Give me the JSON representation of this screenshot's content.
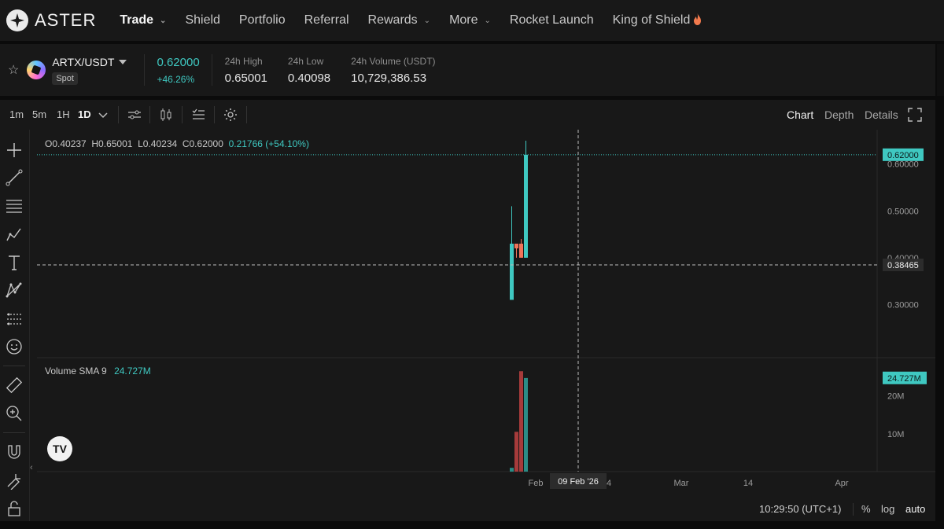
{
  "nav": {
    "brand": "ASTER",
    "items": [
      {
        "label": "Trade",
        "dropdown": true,
        "active": true
      },
      {
        "label": "Shield",
        "dropdown": false
      },
      {
        "label": "Portfolio",
        "dropdown": false
      },
      {
        "label": "Referral",
        "dropdown": false
      },
      {
        "label": "Rewards",
        "dropdown": true
      },
      {
        "label": "More",
        "dropdown": true
      },
      {
        "label": "Rocket Launch",
        "dropdown": false
      },
      {
        "label": "King of Shield",
        "dropdown": false,
        "icon": "flame-icon"
      }
    ]
  },
  "ticker": {
    "pair": "ARTX/USDT",
    "market": "Spot",
    "price": "0.62000",
    "change": "+46.26%",
    "high_label": "24h High",
    "high": "0.65001",
    "low_label": "24h Low",
    "low": "0.40098",
    "volume_label": "24h Volume (USDT)",
    "volume": "10,729,386.53"
  },
  "toolbar": {
    "timeframes": [
      "1m",
      "5m",
      "1H",
      "1D"
    ],
    "active_timeframe": "1D",
    "views": [
      "Chart",
      "Depth",
      "Details"
    ],
    "active_view": "Chart"
  },
  "legend": {
    "o": "O0.40237",
    "h": "H0.65001",
    "l": "L0.40234",
    "c": "C0.62000",
    "chg": "0.21766 (+54.10%)",
    "volume_title": "Volume SMA 9",
    "volume_value": "24.727M"
  },
  "crosshair": {
    "price_label": "0.38465",
    "date_label": "09 Feb '26"
  },
  "chart_data": {
    "type": "candlestick",
    "price_axis": {
      "ticks": [
        "0.60000",
        "0.50000",
        "0.40000",
        "0.30000"
      ],
      "range": [
        0.2,
        0.66
      ]
    },
    "volume_axis": {
      "ticks": [
        "20M",
        "10M"
      ],
      "range": [
        0,
        28
      ]
    },
    "time_axis": {
      "ticks": [
        "Feb",
        "14",
        "Mar",
        "14",
        "Apr"
      ]
    },
    "last_price": 0.62,
    "last_price_label": "0.62000",
    "last_volume_label": "24.727M",
    "candles": [
      {
        "o": 0.31,
        "h": 0.51,
        "l": 0.31,
        "c": 0.43,
        "dir": "up"
      },
      {
        "o": 0.43,
        "h": 0.43,
        "l": 0.4,
        "c": 0.42,
        "dir": "down"
      },
      {
        "o": 0.43,
        "h": 0.44,
        "l": 0.4,
        "c": 0.4,
        "dir": "down"
      },
      {
        "o": 0.4,
        "h": 0.65,
        "l": 0.4,
        "c": 0.62,
        "dir": "up"
      }
    ],
    "volumes": [
      {
        "v": 1,
        "dir": "up"
      },
      {
        "v": 10.5,
        "dir": "down"
      },
      {
        "v": 26.5,
        "dir": "down"
      },
      {
        "v": 24.7,
        "dir": "up"
      }
    ]
  },
  "bottom": {
    "clock": "10:29:50 (UTC+1)",
    "percent": "%",
    "log": "log",
    "auto": "auto"
  },
  "colors": {
    "up": "#3fc8c1",
    "down": "#f0745a",
    "vol_up": "#2b8c86",
    "vol_down": "#a63b3b"
  }
}
